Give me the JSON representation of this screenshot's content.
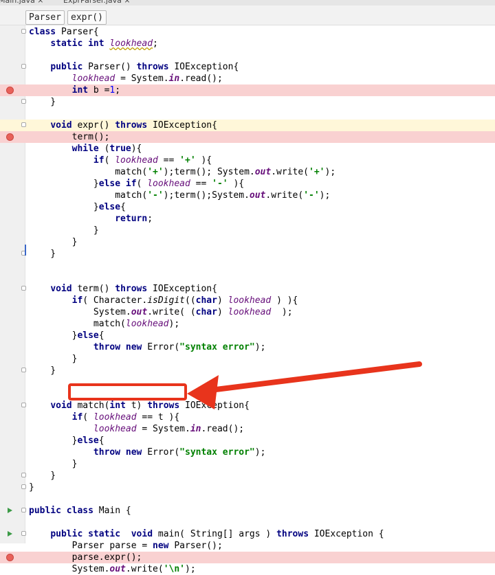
{
  "tabs": [
    {
      "label": "Main.java ×"
    },
    {
      "label": "ExprParser.java ×"
    }
  ],
  "breadcrumb": [
    "Parser",
    "expr()"
  ],
  "code_lines": [
    {
      "text": "class Parser{",
      "bp": false,
      "cur": false,
      "fold": true,
      "run": false
    },
    {
      "text": "    static int lookhead;",
      "bp": false,
      "cur": false,
      "fold": false,
      "run": false
    },
    {
      "text": "",
      "bp": false,
      "cur": false,
      "fold": false,
      "run": false
    },
    {
      "text": "    public Parser() throws IOException{",
      "bp": false,
      "cur": false,
      "fold": true,
      "run": false
    },
    {
      "text": "        lookhead = System.in.read();",
      "bp": false,
      "cur": false,
      "fold": false,
      "run": false
    },
    {
      "text": "        int b =1;",
      "bp": true,
      "cur": false,
      "fold": false,
      "run": false
    },
    {
      "text": "    }",
      "bp": false,
      "cur": false,
      "fold": true,
      "run": false
    },
    {
      "text": "",
      "bp": false,
      "cur": false,
      "fold": false,
      "run": false
    },
    {
      "text": "    void expr() throws IOException{",
      "bp": false,
      "cur": true,
      "fold": true,
      "run": false
    },
    {
      "text": "        term();",
      "bp": true,
      "cur": false,
      "fold": false,
      "run": false
    },
    {
      "text": "        while (true){",
      "bp": false,
      "cur": false,
      "fold": false,
      "run": false
    },
    {
      "text": "            if( lookhead == '+' ){",
      "bp": false,
      "cur": false,
      "fold": false,
      "run": false
    },
    {
      "text": "                match('+');term(); System.out.write('+');",
      "bp": false,
      "cur": false,
      "fold": false,
      "run": false
    },
    {
      "text": "            }else if( lookhead == '-' ){",
      "bp": false,
      "cur": false,
      "fold": false,
      "run": false
    },
    {
      "text": "                match('-');term();System.out.write('-');",
      "bp": false,
      "cur": false,
      "fold": false,
      "run": false
    },
    {
      "text": "            }else{",
      "bp": false,
      "cur": false,
      "fold": false,
      "run": false
    },
    {
      "text": "                return;",
      "bp": false,
      "cur": false,
      "fold": false,
      "run": false
    },
    {
      "text": "            }",
      "bp": false,
      "cur": false,
      "fold": false,
      "run": false
    },
    {
      "text": "        }",
      "bp": false,
      "cur": false,
      "fold": false,
      "run": false
    },
    {
      "text": "    }",
      "bp": false,
      "cur": false,
      "fold": true,
      "run": false
    },
    {
      "text": "",
      "bp": false,
      "cur": false,
      "fold": false,
      "run": false
    },
    {
      "text": "",
      "bp": false,
      "cur": false,
      "fold": false,
      "run": false
    },
    {
      "text": "    void term() throws IOException{",
      "bp": false,
      "cur": false,
      "fold": true,
      "run": false
    },
    {
      "text": "        if( Character.isDigit((char) lookhead ) ){",
      "bp": false,
      "cur": false,
      "fold": false,
      "run": false
    },
    {
      "text": "            System.out.write( (char) lookhead  );",
      "bp": false,
      "cur": false,
      "fold": false,
      "run": false
    },
    {
      "text": "            match(lookhead);",
      "bp": false,
      "cur": false,
      "fold": false,
      "run": false
    },
    {
      "text": "        }else{",
      "bp": false,
      "cur": false,
      "fold": false,
      "run": false
    },
    {
      "text": "            throw new Error(\"syntax error\");",
      "bp": false,
      "cur": false,
      "fold": false,
      "run": false
    },
    {
      "text": "        }",
      "bp": false,
      "cur": false,
      "fold": false,
      "run": false
    },
    {
      "text": "    }",
      "bp": false,
      "cur": false,
      "fold": true,
      "run": false
    },
    {
      "text": "",
      "bp": false,
      "cur": false,
      "fold": false,
      "run": false
    },
    {
      "text": "",
      "bp": false,
      "cur": false,
      "fold": false,
      "run": false
    },
    {
      "text": "    void match(int t) throws IOException{",
      "bp": false,
      "cur": false,
      "fold": true,
      "run": false
    },
    {
      "text": "        if( lookhead == t ){",
      "bp": false,
      "cur": false,
      "fold": false,
      "run": false
    },
    {
      "text": "            lookhead = System.in.read();",
      "bp": false,
      "cur": false,
      "fold": false,
      "run": false
    },
    {
      "text": "        }else{",
      "bp": false,
      "cur": false,
      "fold": false,
      "run": false
    },
    {
      "text": "            throw new Error(\"syntax error\");",
      "bp": false,
      "cur": false,
      "fold": false,
      "run": false
    },
    {
      "text": "        }",
      "bp": false,
      "cur": false,
      "fold": false,
      "run": false
    },
    {
      "text": "    }",
      "bp": false,
      "cur": false,
      "fold": true,
      "run": false
    },
    {
      "text": "}",
      "bp": false,
      "cur": false,
      "fold": true,
      "run": false
    },
    {
      "text": "",
      "bp": false,
      "cur": false,
      "fold": false,
      "run": false
    },
    {
      "text": "public class Main {",
      "bp": false,
      "cur": false,
      "fold": true,
      "run": true
    },
    {
      "text": "",
      "bp": false,
      "cur": false,
      "fold": false,
      "run": false
    },
    {
      "text": "    public static  void main( String[] args ) throws IOException {",
      "bp": false,
      "cur": false,
      "fold": true,
      "run": true
    },
    {
      "text": "        Parser parse = new Parser();",
      "bp": false,
      "cur": false,
      "fold": false,
      "run": false
    },
    {
      "text": "        parse.expr();",
      "bp": true,
      "cur": false,
      "fold": false,
      "run": false
    },
    {
      "text": "        System.out.write('\\n');",
      "bp": false,
      "cur": false,
      "fold": false,
      "run": false
    }
  ],
  "colors": {
    "breakpoint_line": "#f9d1d1",
    "breakpoint_marker": "#e8615a",
    "current_line": "#fff7d9",
    "keyword": "#000080",
    "field": "#660e7a",
    "string": "#008000",
    "annotation_red": "#e8341c"
  }
}
